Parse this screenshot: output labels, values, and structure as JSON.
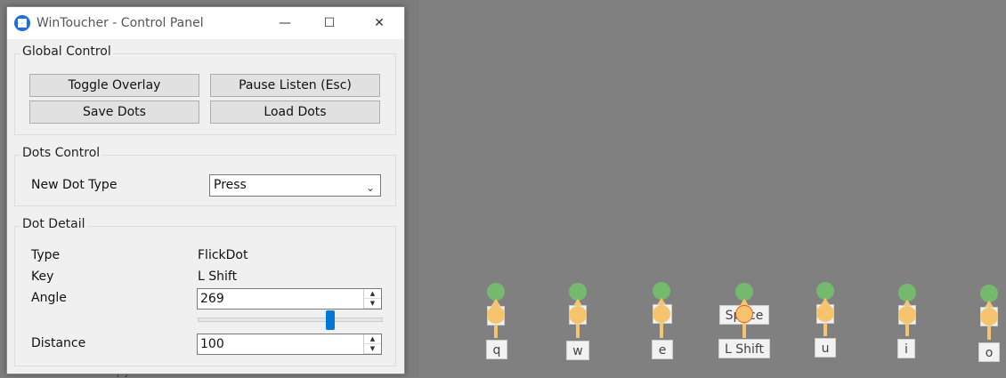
{
  "window": {
    "title": "WinToucher - Control Panel",
    "minimize": "—",
    "maximize": "☐",
    "close": "✕"
  },
  "global_control": {
    "label": "Global Control",
    "toggle_overlay": "Toggle Overlay",
    "pause_listen": "Pause Listen (Esc)",
    "save_dots": "Save Dots",
    "load_dots": "Load Dots"
  },
  "dots_control": {
    "label": "Dots Control",
    "new_dot_type_label": "New Dot Type",
    "new_dot_type_value": "Press"
  },
  "dot_detail": {
    "label": "Dot Detail",
    "type_label": "Type",
    "type_value": "FlickDot",
    "key_label": "Key",
    "key_value": "L Shift",
    "angle_label": "Angle",
    "angle_value": "269",
    "distance_label": "Distance",
    "distance_value": "100"
  },
  "overlay_keys": [
    "q",
    "w",
    "e",
    "Space",
    "L Shift",
    "u",
    "i",
    "o"
  ],
  "background_text": "main .py  wintoucher",
  "colors": {
    "dot_green": "#74b96e",
    "dot_orange": "#f7c46e",
    "accent": "#0078d7"
  }
}
